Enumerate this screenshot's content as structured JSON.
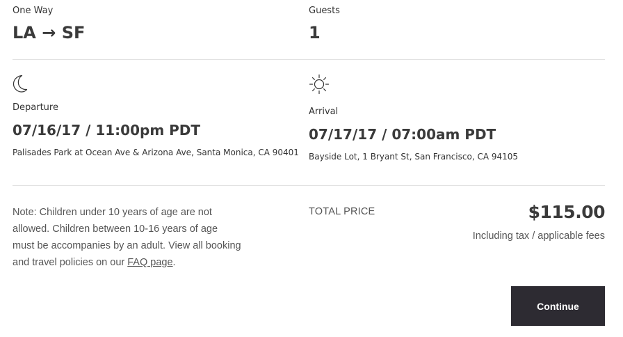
{
  "trip": {
    "type_label": "One Way",
    "route": "LA → SF",
    "guests_label": "Guests",
    "guests_value": "1"
  },
  "departure": {
    "icon": "moon-icon",
    "label": "Departure",
    "datetime": "07/16/17 / 11:00pm PDT",
    "address": "Palisades Park at Ocean Ave & Arizona Ave, Santa Monica, CA 90401"
  },
  "arrival": {
    "icon": "sun-icon",
    "label": "Arrival",
    "datetime": "07/17/17 / 07:00am PDT",
    "address": "Bayside Lot, 1 Bryant St, San Francisco, CA 94105"
  },
  "note": {
    "text": "Note: Children under 10 years of age are not allowed. Children between 10-16 years of age must be accompanies by an adult. View all booking and travel policies on our ",
    "link_text": "FAQ page",
    "end": "."
  },
  "pricing": {
    "total_label": "TOTAL PRICE",
    "amount": "$115.00",
    "fees_text": "Including tax / applicable fees"
  },
  "actions": {
    "continue_label": "Continue",
    "button_color": "#2d2b32"
  }
}
